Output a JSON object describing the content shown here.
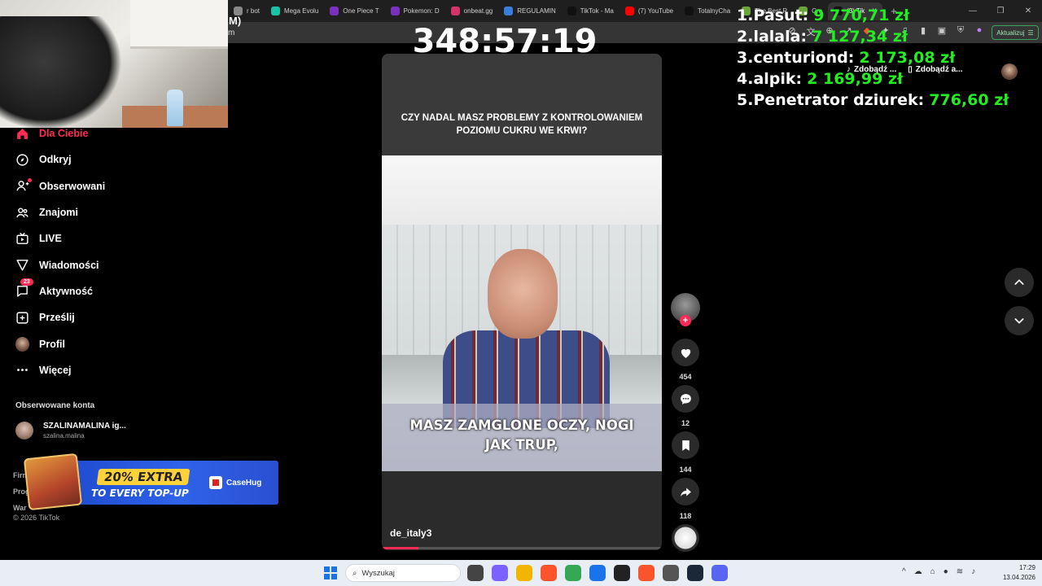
{
  "browser": {
    "tabs": [
      {
        "label": "r bot",
        "color": "#888888"
      },
      {
        "label": "Mega Evolu",
        "color": "#19c3a5"
      },
      {
        "label": "One Piece T",
        "color": "#7b2fbf"
      },
      {
        "label": "Pokemon: D",
        "color": "#7b2fbf"
      },
      {
        "label": "onbeat.gg",
        "color": "#d6336c"
      },
      {
        "label": "REGULAMIN",
        "color": "#3b7ddd"
      },
      {
        "label": "TikTok - Ma",
        "color": "#111111"
      },
      {
        "label": "(7) YouTube",
        "color": "#ff0000"
      },
      {
        "label": "TotalnyCha",
        "color": "#111111"
      },
      {
        "label": "The Best R",
        "color": "#6ba539"
      },
      {
        "label": "Cre",
        "color": "#6ba539"
      },
      {
        "label": "(3) Tik",
        "color": "#111111",
        "active": true
      }
    ],
    "tab_close": "×",
    "new_tab": "+",
    "window_controls": [
      "—",
      "❐",
      "✕"
    ],
    "address_fragment_top": "M)",
    "address_fragment": "m",
    "update_button": "Aktualizuj"
  },
  "overlay": {
    "timer": "348:57:19",
    "leaderboard": [
      {
        "rank": "1.",
        "name": "Pasut:",
        "amount": "9 770,71 zł"
      },
      {
        "rank": "2.",
        "name": "lalala:",
        "amount": "7 127,34 zł"
      },
      {
        "rank": "3.",
        "name": "centuriond:",
        "amount": "2 173,08 zł"
      },
      {
        "rank": "4.",
        "name": "alpik:",
        "amount": "2 169,99 zł"
      },
      {
        "rank": "5.",
        "name": "Penetrator dziurek:",
        "amount": "776,60 zł"
      }
    ],
    "download_links": [
      "Zdobądź ...",
      "Zdobądź a..."
    ]
  },
  "sidebar": {
    "items": [
      {
        "label": "Dla Ciebie",
        "icon": "home-icon",
        "active": true
      },
      {
        "label": "Odkryj",
        "icon": "compass-icon"
      },
      {
        "label": "Obserwowani",
        "icon": "following-icon"
      },
      {
        "label": "Znajomi",
        "icon": "friends-icon"
      },
      {
        "label": "LIVE",
        "icon": "live-icon"
      },
      {
        "label": "Wiadomości",
        "icon": "messages-icon"
      },
      {
        "label": "Aktywność",
        "icon": "activity-icon",
        "badge": "23"
      },
      {
        "label": "Prześlij",
        "icon": "upload-icon"
      },
      {
        "label": "Profil",
        "icon": "profile-avatar"
      },
      {
        "label": "Więcej",
        "icon": "more-icon"
      }
    ],
    "followed_title": "Obserwowane konta",
    "followed_accounts": [
      {
        "name": "SZALINAMALINA ig...",
        "handle": "szalina.malina"
      }
    ],
    "footer_links": [
      "Firm",
      "Prog",
      "War"
    ],
    "copyright": "© 2026 TikTok"
  },
  "ad": {
    "line1": "20% EXTRA",
    "line2": "TO EVERY TOP-UP",
    "brand": "CaseHug"
  },
  "video": {
    "question": "CZY NADAL MASZ PROBLEMY Z KONTROLOWANIEM POZIOMU CUKRU WE KRWI?",
    "caption_line1": "MASZ ZAMGLONE OCZY, NOGI",
    "caption_line2": "JAK TRUP,",
    "author": "de_italy3",
    "progress": 0.13
  },
  "actions": {
    "likes": "454",
    "comments": "12",
    "saves": "144",
    "shares": "118",
    "follow_plus": "+"
  },
  "taskbar": {
    "search_placeholder": "Wyszukaj",
    "time": "17:29",
    "date": "13.04.2026",
    "apps": [
      {
        "name": "task-view",
        "color": "#444444"
      },
      {
        "name": "copilot",
        "color": "#7b61ff"
      },
      {
        "name": "file-explorer",
        "color": "#f2b600"
      },
      {
        "name": "brave",
        "color": "#fb542b"
      },
      {
        "name": "chrome",
        "color": "#34a853"
      },
      {
        "name": "store",
        "color": "#1a73e8"
      },
      {
        "name": "epic",
        "color": "#222222"
      },
      {
        "name": "brave-beta",
        "color": "#fb542b"
      },
      {
        "name": "calculator",
        "color": "#555555"
      },
      {
        "name": "steam",
        "color": "#1b2838"
      },
      {
        "name": "discord",
        "color": "#5865f2"
      }
    ]
  }
}
